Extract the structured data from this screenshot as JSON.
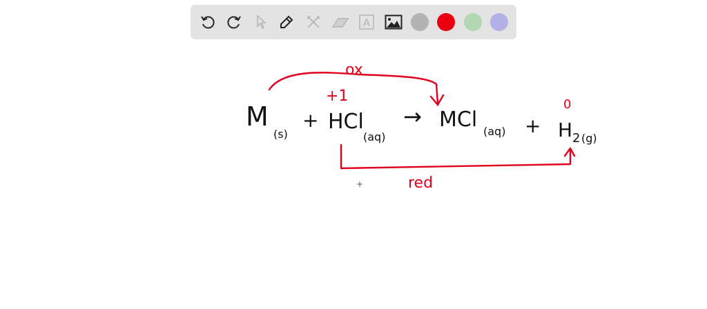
{
  "toolbar": {
    "tools": [
      "undo-icon",
      "redo-icon",
      "select-icon",
      "pen-icon",
      "tools-icon",
      "eraser-icon",
      "text-icon",
      "image-icon"
    ],
    "text_tool_glyph": "A",
    "colors": [
      "#b3b3b3",
      "#e8000f",
      "#b3d6b3",
      "#b3b0e8"
    ]
  },
  "board": {
    "reactant1": "M",
    "reactant1_state": "(s)",
    "plus1": "+",
    "reactant2": "HCl",
    "reactant2_state": "(aq)",
    "arrow": "→",
    "product1": "MCl",
    "product1_state": "(aq)",
    "plus2": "+",
    "product2": "H",
    "product2_sub": "2",
    "product2_state": "(g)",
    "annotations": {
      "ox": "ox",
      "h_ox_state": "+1",
      "h2_ox_state": "0",
      "red": "red"
    },
    "ink_colors": {
      "black": "#111111",
      "red": "#e0001b"
    }
  },
  "cursor": "+"
}
